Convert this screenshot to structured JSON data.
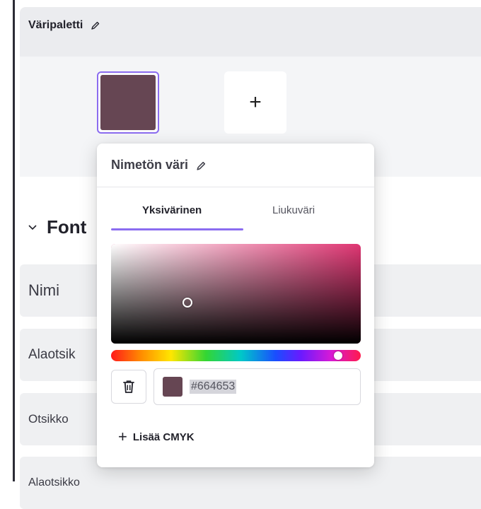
{
  "palette": {
    "title": "Väripaletti",
    "selected_color": "#664653",
    "add_label": "+"
  },
  "fonts": {
    "heading": "Font",
    "rows": [
      {
        "label": "Nimi"
      },
      {
        "label": "Alaotsik"
      },
      {
        "label": "Otsikko"
      },
      {
        "label": "Alaotsikko"
      }
    ]
  },
  "picker": {
    "title": "Nimetön väri",
    "tabs": [
      {
        "label": "Yksivärinen",
        "active": true
      },
      {
        "label": "Liukuväri",
        "active": false
      }
    ],
    "hue_color": "#e03673",
    "hex_value": "#664653",
    "accent": "#8b6cf0",
    "add_cmyk_label": "Lisää CMYK",
    "delete_icon": "trash-icon"
  }
}
